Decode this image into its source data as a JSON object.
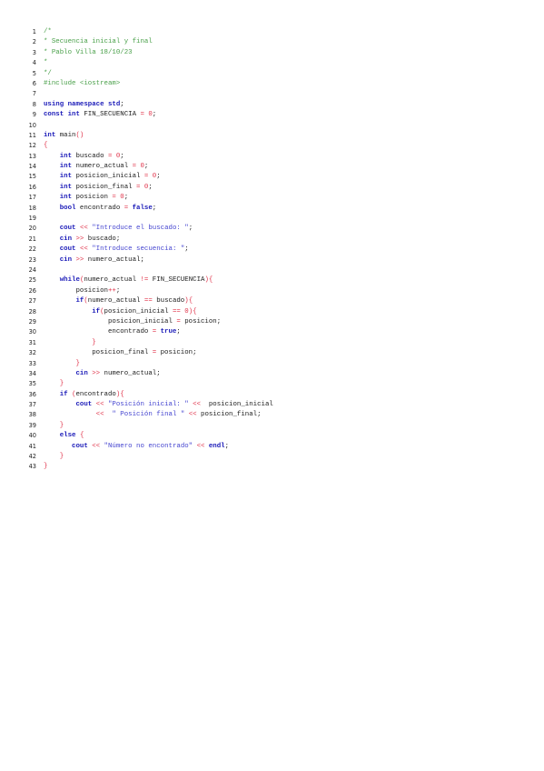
{
  "lines": [
    [
      [
        "cm",
        "/*"
      ]
    ],
    [
      [
        "cm",
        "* Secuencia inicial y final"
      ]
    ],
    [
      [
        "cm",
        "* Pablo Villa 18/10/23"
      ]
    ],
    [
      [
        "cm",
        "*"
      ]
    ],
    [
      [
        "cm",
        "*/"
      ]
    ],
    [
      [
        "pp",
        "#include <iostream>"
      ]
    ],
    [],
    [
      [
        "kw",
        "using namespace std"
      ],
      [
        "id",
        ";"
      ]
    ],
    [
      [
        "kw",
        "const int"
      ],
      [
        "id",
        " FIN_SECUENCIA "
      ],
      [
        "op",
        "="
      ],
      [
        "id",
        " "
      ],
      [
        "nu",
        "0"
      ],
      [
        "id",
        ";"
      ]
    ],
    [],
    [
      [
        "kw",
        "int"
      ],
      [
        "id",
        " main"
      ],
      [
        "br",
        "()"
      ]
    ],
    [
      [
        "br",
        "{"
      ]
    ],
    [
      [
        "id",
        "    "
      ],
      [
        "kw",
        "int"
      ],
      [
        "id",
        " buscado "
      ],
      [
        "op",
        "="
      ],
      [
        "id",
        " "
      ],
      [
        "nu",
        "0"
      ],
      [
        "id",
        ";"
      ]
    ],
    [
      [
        "id",
        "    "
      ],
      [
        "kw",
        "int"
      ],
      [
        "id",
        " numero_actual "
      ],
      [
        "op",
        "="
      ],
      [
        "id",
        " "
      ],
      [
        "nu",
        "0"
      ],
      [
        "id",
        ";"
      ]
    ],
    [
      [
        "id",
        "    "
      ],
      [
        "kw",
        "int"
      ],
      [
        "id",
        " posicion_inicial "
      ],
      [
        "op",
        "="
      ],
      [
        "id",
        " "
      ],
      [
        "nu",
        "0"
      ],
      [
        "id",
        ";"
      ]
    ],
    [
      [
        "id",
        "    "
      ],
      [
        "kw",
        "int"
      ],
      [
        "id",
        " posicion_final "
      ],
      [
        "op",
        "="
      ],
      [
        "id",
        " "
      ],
      [
        "nu",
        "0"
      ],
      [
        "id",
        ";"
      ]
    ],
    [
      [
        "id",
        "    "
      ],
      [
        "kw",
        "int"
      ],
      [
        "id",
        " posicion "
      ],
      [
        "op",
        "="
      ],
      [
        "id",
        " "
      ],
      [
        "nu",
        "0"
      ],
      [
        "id",
        ";"
      ]
    ],
    [
      [
        "id",
        "    "
      ],
      [
        "kw",
        "bool"
      ],
      [
        "id",
        " encontrado "
      ],
      [
        "op",
        "="
      ],
      [
        "id",
        " "
      ],
      [
        "kw",
        "false"
      ],
      [
        "id",
        ";"
      ]
    ],
    [],
    [
      [
        "id",
        "    "
      ],
      [
        "kw",
        "cout"
      ],
      [
        "id",
        " "
      ],
      [
        "op",
        "<<"
      ],
      [
        "id",
        " "
      ],
      [
        "st",
        "\"Introduce el buscado: \""
      ],
      [
        "id",
        ";"
      ]
    ],
    [
      [
        "id",
        "    "
      ],
      [
        "kw",
        "cin"
      ],
      [
        "id",
        " "
      ],
      [
        "op",
        ">>"
      ],
      [
        "id",
        " buscado;"
      ]
    ],
    [
      [
        "id",
        "    "
      ],
      [
        "kw",
        "cout"
      ],
      [
        "id",
        " "
      ],
      [
        "op",
        "<<"
      ],
      [
        "id",
        " "
      ],
      [
        "st",
        "\"Introduce secuencia: \""
      ],
      [
        "id",
        ";"
      ]
    ],
    [
      [
        "id",
        "    "
      ],
      [
        "kw",
        "cin"
      ],
      [
        "id",
        " "
      ],
      [
        "op",
        ">>"
      ],
      [
        "id",
        " numero_actual;"
      ]
    ],
    [],
    [
      [
        "id",
        "    "
      ],
      [
        "kw",
        "while"
      ],
      [
        "br",
        "("
      ],
      [
        "id",
        "numero_actual "
      ],
      [
        "op",
        "!="
      ],
      [
        "id",
        " FIN_SECUENCIA"
      ],
      [
        "br",
        ")"
      ],
      [
        "br",
        "{"
      ]
    ],
    [
      [
        "id",
        "        posicion"
      ],
      [
        "op",
        "++"
      ],
      [
        "id",
        ";"
      ]
    ],
    [
      [
        "id",
        "        "
      ],
      [
        "kw",
        "if"
      ],
      [
        "br",
        "("
      ],
      [
        "id",
        "numero_actual "
      ],
      [
        "op",
        "=="
      ],
      [
        "id",
        " buscado"
      ],
      [
        "br",
        ")"
      ],
      [
        "br",
        "{"
      ]
    ],
    [
      [
        "id",
        "            "
      ],
      [
        "kw",
        "if"
      ],
      [
        "br",
        "("
      ],
      [
        "id",
        "posicion_inicial "
      ],
      [
        "op",
        "=="
      ],
      [
        "id",
        " "
      ],
      [
        "nu",
        "0"
      ],
      [
        "br",
        ")"
      ],
      [
        "br",
        "{"
      ]
    ],
    [
      [
        "id",
        "                posicion_inicial "
      ],
      [
        "op",
        "="
      ],
      [
        "id",
        " posicion;"
      ]
    ],
    [
      [
        "id",
        "                encontrado "
      ],
      [
        "op",
        "="
      ],
      [
        "id",
        " "
      ],
      [
        "kw",
        "true"
      ],
      [
        "id",
        ";"
      ]
    ],
    [
      [
        "id",
        "            "
      ],
      [
        "br",
        "}"
      ]
    ],
    [
      [
        "id",
        "            posicion_final "
      ],
      [
        "op",
        "="
      ],
      [
        "id",
        " posicion;"
      ]
    ],
    [
      [
        "id",
        "        "
      ],
      [
        "br",
        "}"
      ]
    ],
    [
      [
        "id",
        "        "
      ],
      [
        "kw",
        "cin"
      ],
      [
        "id",
        " "
      ],
      [
        "op",
        ">>"
      ],
      [
        "id",
        " numero_actual;"
      ]
    ],
    [
      [
        "id",
        "    "
      ],
      [
        "br",
        "}"
      ]
    ],
    [
      [
        "id",
        "    "
      ],
      [
        "kw",
        "if"
      ],
      [
        "id",
        " "
      ],
      [
        "br",
        "("
      ],
      [
        "id",
        "encontrado"
      ],
      [
        "br",
        ")"
      ],
      [
        "br",
        "{"
      ]
    ],
    [
      [
        "id",
        "        "
      ],
      [
        "kw",
        "cout"
      ],
      [
        "id",
        " "
      ],
      [
        "op",
        "<<"
      ],
      [
        "id",
        " "
      ],
      [
        "st",
        "\"Posición inicial: \""
      ],
      [
        "id",
        " "
      ],
      [
        "op",
        "<<"
      ],
      [
        "id",
        "  posicion_inicial"
      ]
    ],
    [
      [
        "id",
        "             "
      ],
      [
        "op",
        "<<"
      ],
      [
        "id",
        "  "
      ],
      [
        "st",
        "\" Posición final \""
      ],
      [
        "id",
        " "
      ],
      [
        "op",
        "<<"
      ],
      [
        "id",
        " posicion_final;"
      ]
    ],
    [
      [
        "id",
        "    "
      ],
      [
        "br",
        "}"
      ]
    ],
    [
      [
        "id",
        "    "
      ],
      [
        "kw",
        "else"
      ],
      [
        "id",
        " "
      ],
      [
        "br",
        "{"
      ]
    ],
    [
      [
        "id",
        "       "
      ],
      [
        "kw",
        "cout"
      ],
      [
        "id",
        " "
      ],
      [
        "op",
        "<<"
      ],
      [
        "id",
        " "
      ],
      [
        "st",
        "\"Número no encontrado\""
      ],
      [
        "id",
        " "
      ],
      [
        "op",
        "<<"
      ],
      [
        "id",
        " "
      ],
      [
        "kw",
        "endl"
      ],
      [
        "id",
        ";"
      ]
    ],
    [
      [
        "id",
        "    "
      ],
      [
        "br",
        "}"
      ]
    ],
    [
      [
        "br",
        "}"
      ]
    ]
  ]
}
